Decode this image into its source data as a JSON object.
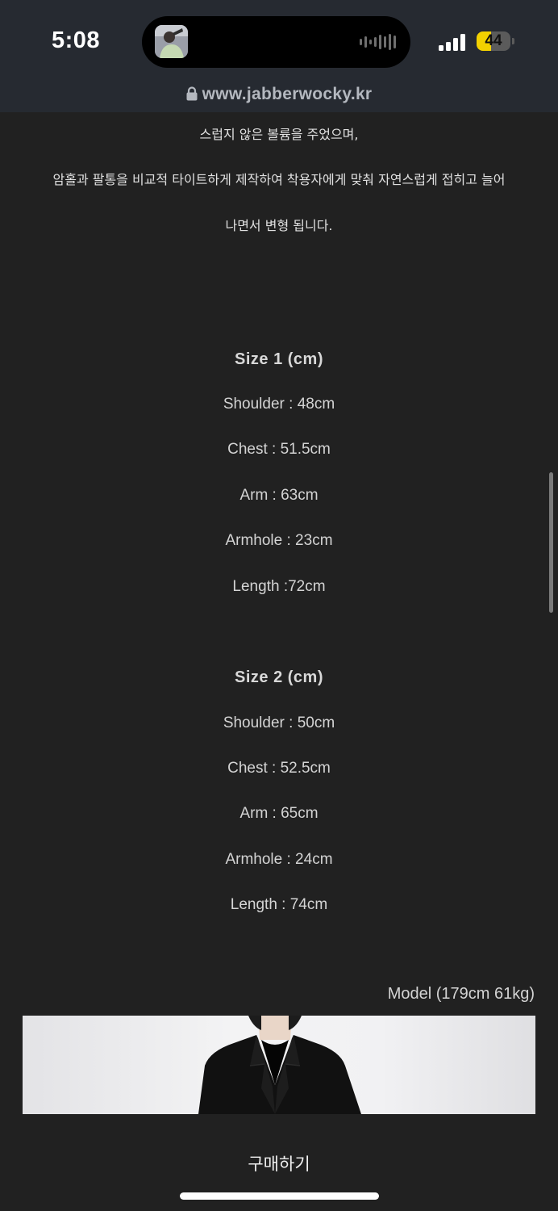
{
  "status_bar": {
    "time": "5:08",
    "battery": "44",
    "battery_level": 0.44,
    "signal_bars": 4
  },
  "browser": {
    "url": "www.jabberwocky.kr"
  },
  "description": [
    "스럽지 않은 볼륨을 주었으며,",
    "암홀과 팔통을 비교적 타이트하게 제작하여  착용자에게 맞춰 자연스럽게 접히고 늘어",
    "나면서 변형 됩니다."
  ],
  "size1": {
    "title": "Size 1 (cm)",
    "rows": [
      "Shoulder : 48cm",
      "Chest : 51.5cm",
      "Arm : 63cm",
      "Armhole : 23cm",
      "Length :72cm"
    ]
  },
  "size2": {
    "title": "Size 2 (cm)",
    "rows": [
      "Shoulder : 50cm",
      "Chest : 52.5cm",
      "Arm : 65cm",
      "Armhole : 24cm",
      "Length : 74cm"
    ]
  },
  "model": {
    "caption": "Model (179cm 61kg)"
  },
  "buy_button": {
    "label": "구매하기"
  },
  "colors": {
    "page_bg": "#212121",
    "header_bg": "#262a31",
    "battery": "#f3d100"
  }
}
